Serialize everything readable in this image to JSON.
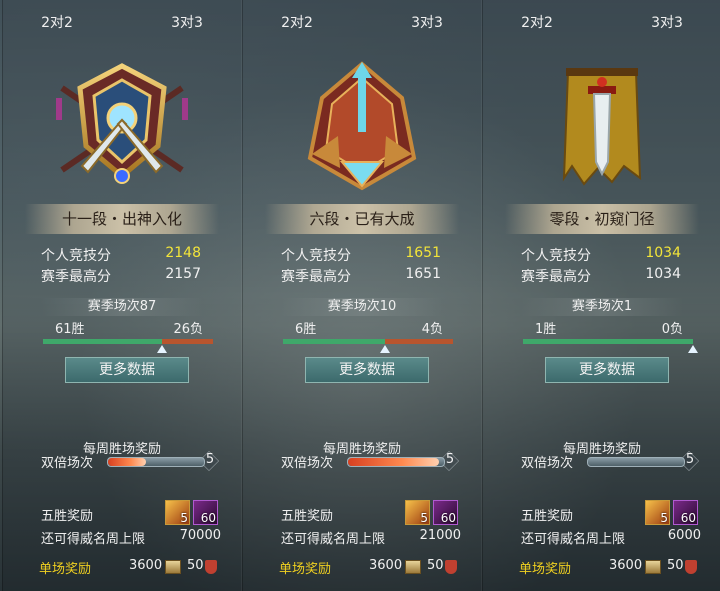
{
  "panels": [
    {
      "tabs": [
        "2对2",
        "3对3"
      ],
      "emblem": "crossed-swords-emblem-icon",
      "rank": "十一段・出神入化",
      "personal_label": "个人竞技分",
      "personal_value": "2148",
      "season_high_label": "赛季最高分",
      "season_high_value": "2157",
      "season_matches": "赛季场次87",
      "wins": "61胜",
      "losses": "26负",
      "win_ratio": 0.701,
      "more_button": "更多数据",
      "weekly_title": "每周胜场奖励",
      "double_label": "双倍场次",
      "double_count": "5",
      "double_progress": 0.4,
      "five_win_label": "五胜奖励",
      "item1_count": "5",
      "item2_count": "60",
      "cap_label": "还可得威名周上限",
      "cap_value": "70000",
      "single_label": "单场奖励",
      "single_value1": "3600",
      "single_value2": "50"
    },
    {
      "tabs": [
        "2对2",
        "3对3"
      ],
      "emblem": "arrow-crest-emblem-icon",
      "rank": "六段・已有大成",
      "personal_label": "个人竞技分",
      "personal_value": "1651",
      "season_high_label": "赛季最高分",
      "season_high_value": "1651",
      "season_matches": "赛季场次10",
      "wins": "6胜",
      "losses": "4负",
      "win_ratio": 0.6,
      "more_button": "更多数据",
      "weekly_title": "每周胜场奖励",
      "double_label": "双倍场次",
      "double_count": "5",
      "double_progress": 0.95,
      "five_win_label": "五胜奖励",
      "item1_count": "5",
      "item2_count": "60",
      "cap_label": "还可得威名周上限",
      "cap_value": "21000",
      "single_label": "单场奖励",
      "single_value1": "3600",
      "single_value2": "50"
    },
    {
      "tabs": [
        "2对2",
        "3对3"
      ],
      "emblem": "banner-sword-emblem-icon",
      "rank": "零段・初窥门径",
      "personal_label": "个人竞技分",
      "personal_value": "1034",
      "season_high_label": "赛季最高分",
      "season_high_value": "1034",
      "season_matches": "赛季场次1",
      "wins": "1胜",
      "losses": "0负",
      "win_ratio": 1.0,
      "more_button": "更多数据",
      "weekly_title": "每周胜场奖励",
      "double_label": "双倍场次",
      "double_count": "5",
      "double_progress": 0.0,
      "five_win_label": "五胜奖励",
      "item1_count": "5",
      "item2_count": "60",
      "cap_label": "还可得威名周上限",
      "cap_value": "6000",
      "single_label": "单场奖励",
      "single_value1": "3600",
      "single_value2": "50"
    }
  ]
}
